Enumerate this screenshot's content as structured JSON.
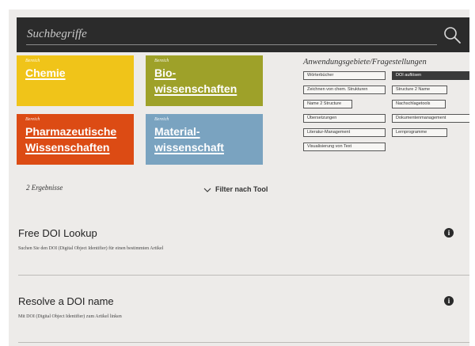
{
  "search": {
    "placeholder": "Suchbegriffe"
  },
  "categories": [
    {
      "pre": "Bereich",
      "lines": [
        "Chemie"
      ],
      "color": "#f0c419"
    },
    {
      "pre": "Bereich",
      "lines": [
        "Bio-",
        "wissenschaften"
      ],
      "color": "#9ea129"
    },
    {
      "pre": "Bereich",
      "lines": [
        "Pharmazeutische",
        "Wissenschaften"
      ],
      "color": "#dc4b14"
    },
    {
      "pre": "Bereich",
      "lines": [
        "Material-",
        "wissenschaft"
      ],
      "color": "#7aa3c0"
    }
  ],
  "applications": {
    "title": "Anwendungsgebiete/Fragestellungen",
    "items": [
      {
        "label": "Wörterbücher",
        "active": false
      },
      {
        "label": "DOI auflösen",
        "active": true
      },
      {
        "label": "Zeichnen von chem. Strukturen",
        "active": false
      },
      {
        "label": "Structure 2 Name",
        "active": false
      },
      {
        "label": "Name 2 Structure",
        "active": false
      },
      {
        "label": "Nachschlagetools",
        "active": false
      },
      {
        "label": "Übersetzungen",
        "active": false
      },
      {
        "label": "Dokumentenmanagement",
        "active": false
      },
      {
        "label": "Literatur-Management",
        "active": false
      },
      {
        "label": "Lernprogramme",
        "active": false
      },
      {
        "label": "Visualisierung von Text",
        "active": false
      }
    ]
  },
  "results": {
    "count_label": "2 Ergebnisse",
    "filter_label": "Filter nach Tool",
    "items": [
      {
        "title": "Free DOI Lookup",
        "description": "Suchen Sie den DOI (Digital Object Identifier) für einen bestimmten Artikel"
      },
      {
        "title": "Resolve a DOI name",
        "description": "Mit DOI (Digital Object Identifier) zum Artikel linken"
      }
    ]
  },
  "colors": {
    "active_chip": "#3a3a3a",
    "search_bar": "#2b2b2b"
  }
}
